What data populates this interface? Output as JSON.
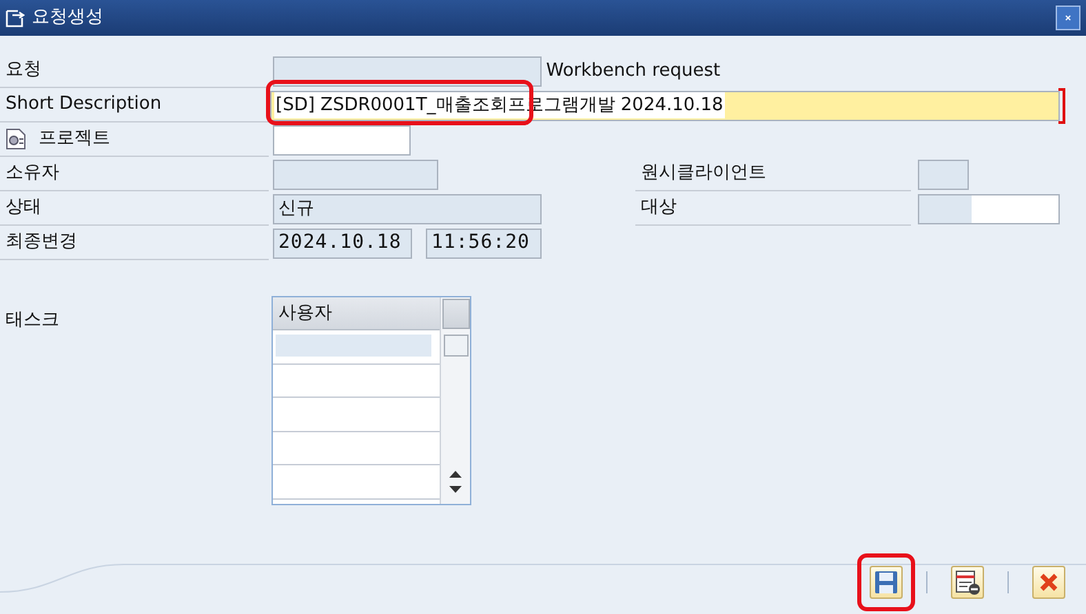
{
  "window": {
    "title": "요청생성"
  },
  "request": {
    "label": "요청",
    "type_text": "Workbench request"
  },
  "short_description": {
    "label": "Short Description",
    "value": "[SD] ZSDR0001T_매출조회프로그램개발 2024.10.18",
    "required": true,
    "highlighted": true
  },
  "project": {
    "label": "프로젝트"
  },
  "owner": {
    "label": "소유자"
  },
  "source_client": {
    "label": "원시클라이언트"
  },
  "status": {
    "label": "상태",
    "value": "신규"
  },
  "target": {
    "label": "대상"
  },
  "last_changed": {
    "label": "최종변경",
    "date": "2024.10.18",
    "time": "11:56:20"
  },
  "tasks": {
    "label": "태스크",
    "columns": [
      "사용자"
    ]
  },
  "buttons": [
    {
      "kind": "save",
      "highlighted": true
    },
    {
      "kind": "delete",
      "highlighted": false
    },
    {
      "kind": "cancel",
      "highlighted": false
    }
  ]
}
